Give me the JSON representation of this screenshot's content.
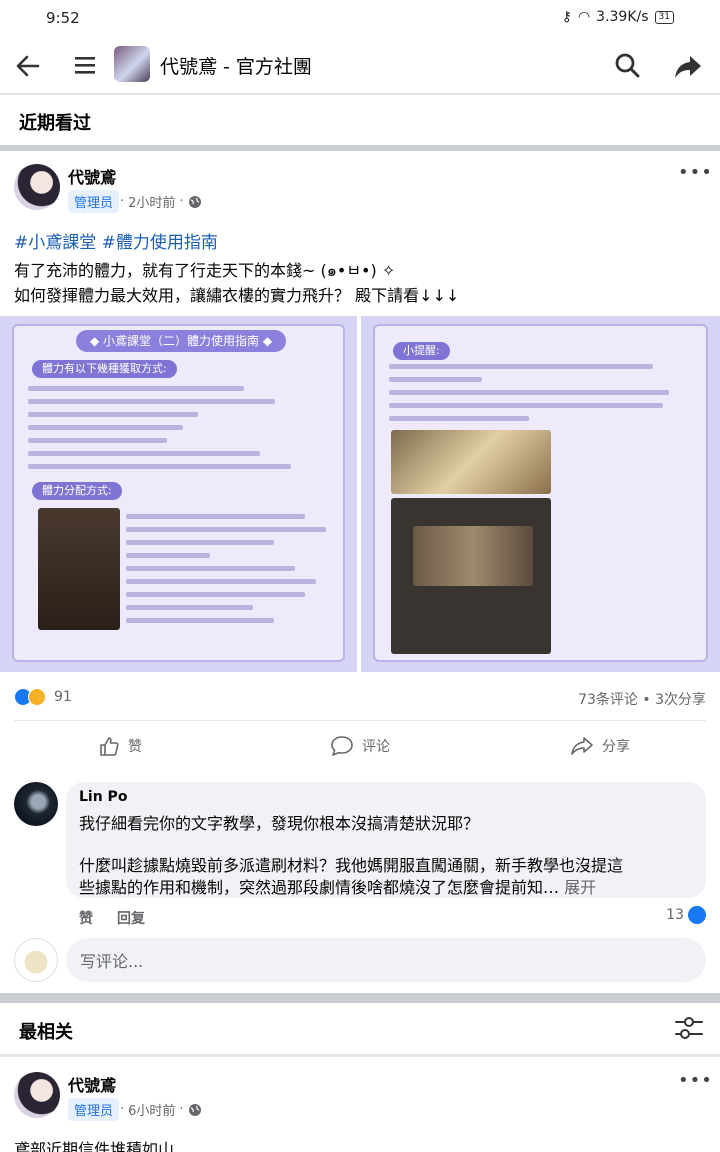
{
  "status_bar": {
    "time": "9:52",
    "net_speed": "3.39K/s",
    "battery": "31"
  },
  "header": {
    "title": "代號鳶 - 官方社團"
  },
  "recent_section": {
    "title": "近期看过"
  },
  "post1": {
    "author": "代號鳶",
    "badge": "管理员",
    "time": "2小时前",
    "hashtags": "#小鳶課堂 #體力使用指南",
    "lines": [
      "有了充沛的體力，就有了行走天下的本錢~ (๑•ㅂ•) ✧",
      "如何發揮體力最大效用，讓繡衣樓的實力飛升？ 殿下請看↓↓↓"
    ],
    "image1": {
      "title": "◆ 小鳶課堂（二）體力使用指南 ◆",
      "section_a": "體力有以下幾種獲取方式:",
      "section_b": "體力分配方式:"
    },
    "image2": {
      "section_a": "小提醒:"
    },
    "reaction_count": "91",
    "stats": "73条评论 • 3次分享",
    "actions": {
      "like": "赞",
      "comment": "评论",
      "share": "分享"
    }
  },
  "comment": {
    "author": "Lin Po",
    "line1": "我仔細看完你的文字教學，發現你根本沒搞清楚狀況耶？",
    "line2": "什麼叫趁據點燒毀前多派遣刷材料？我他媽開服直闖通關，新手教學也沒提這",
    "line3": "些據點的作用和機制，突然過那段劇情後啥都燒沒了怎麼會提前知…",
    "see_more": "展开",
    "like": "赞",
    "reply": "回复",
    "like_count": "13"
  },
  "write_comment": {
    "placeholder": "写评论..."
  },
  "relevant_section": {
    "title": "最相关"
  },
  "post2": {
    "author": "代號鳶",
    "badge": "管理员",
    "time": "6小时前",
    "first_line": "鳶部近期信件堆積如山"
  }
}
